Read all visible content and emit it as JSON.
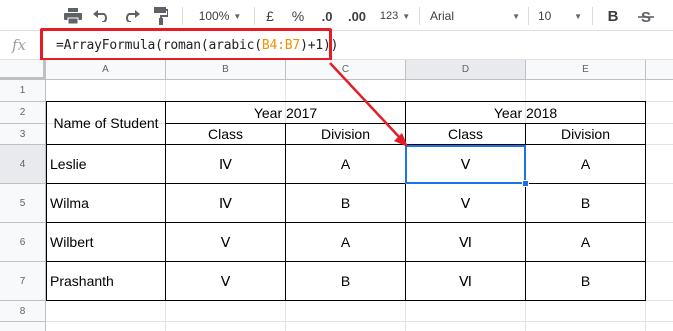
{
  "toolbar": {
    "zoom": "100%",
    "currency": "£",
    "percent": "%",
    "decrease_decimal": ".0",
    "increase_decimal": ".00",
    "more_formats": "123",
    "font": "Arial",
    "font_size": "10",
    "bold": "B"
  },
  "formula_bar": {
    "fx": "fx",
    "parts": [
      "=ArrayFormula(roman(arabic(",
      "B4:B7",
      ")+1))"
    ]
  },
  "columns": [
    "A",
    "B",
    "C",
    "D",
    "E"
  ],
  "rows": [
    "1",
    "2",
    "3",
    "4",
    "5",
    "6",
    "7",
    "8"
  ],
  "table": {
    "header_name": "Name of Student",
    "year1": "Year 2017",
    "year2": "Year 2018",
    "sub_headers": [
      "Class",
      "Division",
      "Class",
      "Division"
    ],
    "data": [
      [
        "Leslie",
        "Ⅳ",
        "A",
        "Ⅴ",
        "A"
      ],
      [
        "Wilma",
        "Ⅳ",
        "B",
        "Ⅴ",
        "B"
      ],
      [
        "Wilbert",
        "Ⅴ",
        "A",
        "Ⅵ",
        "A"
      ],
      [
        "Prashanth",
        "Ⅴ",
        "B",
        "Ⅵ",
        "B"
      ]
    ]
  },
  "colors": {
    "annotation_red": "#e51c23",
    "selection_blue": "#1a73e8",
    "range_ref_orange": "#f09300"
  }
}
